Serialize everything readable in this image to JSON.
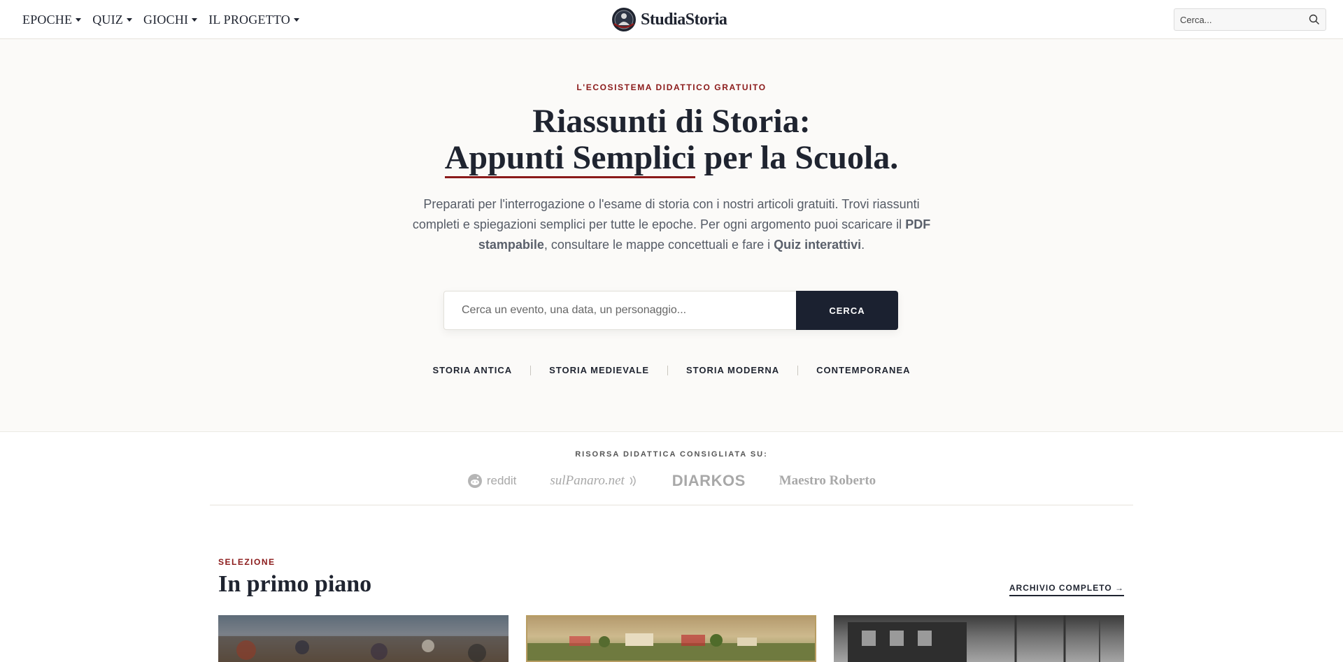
{
  "nav": {
    "items": [
      {
        "label": "EPOCHE"
      },
      {
        "label": "QUIZ"
      },
      {
        "label": "GIOCHI"
      },
      {
        "label": "IL PROGETTO"
      }
    ],
    "brand": "StudiaStoria",
    "search_placeholder": "Cerca..."
  },
  "hero": {
    "eyebrow": "L'ECOSISTEMA DIDATTICO GRATUITO",
    "title_line1": "Riassunti di Storia:",
    "title_underlined": "Appunti Semplici",
    "title_rest": " per la Scuola.",
    "lead_part1": "Preparati per l'interrogazione o l'esame di storia con i nostri articoli gratuiti. Trovi riassunti completi e spiegazioni semplici per tutte le epoche. Per ogni argomento puoi scaricare il ",
    "lead_bold1": "PDF stampabile",
    "lead_part2": ", consultare le mappe concettuali e fare i ",
    "lead_bold2": "Quiz interattivi",
    "lead_part3": ".",
    "search_placeholder": "Cerca un evento, una data, un personaggio...",
    "search_button": "CERCA",
    "epochs": [
      "STORIA ANTICA",
      "STORIA MEDIEVALE",
      "STORIA MODERNA",
      "CONTEMPORANEA"
    ]
  },
  "trust": {
    "label": "RISORSA DIDATTICA CONSIGLIATA SU:",
    "logos": [
      "reddit",
      "sulPanaro.net",
      "DIARKOS",
      "Maestro Roberto"
    ]
  },
  "featured": {
    "eyebrow": "SELEZIONE",
    "title": "In primo piano",
    "archive_link": "ARCHIVIO COMPLETO →"
  },
  "colors": {
    "accent": "#8b1a1a",
    "dark": "#1b2130",
    "hero_bg": "#fbfaf8"
  }
}
